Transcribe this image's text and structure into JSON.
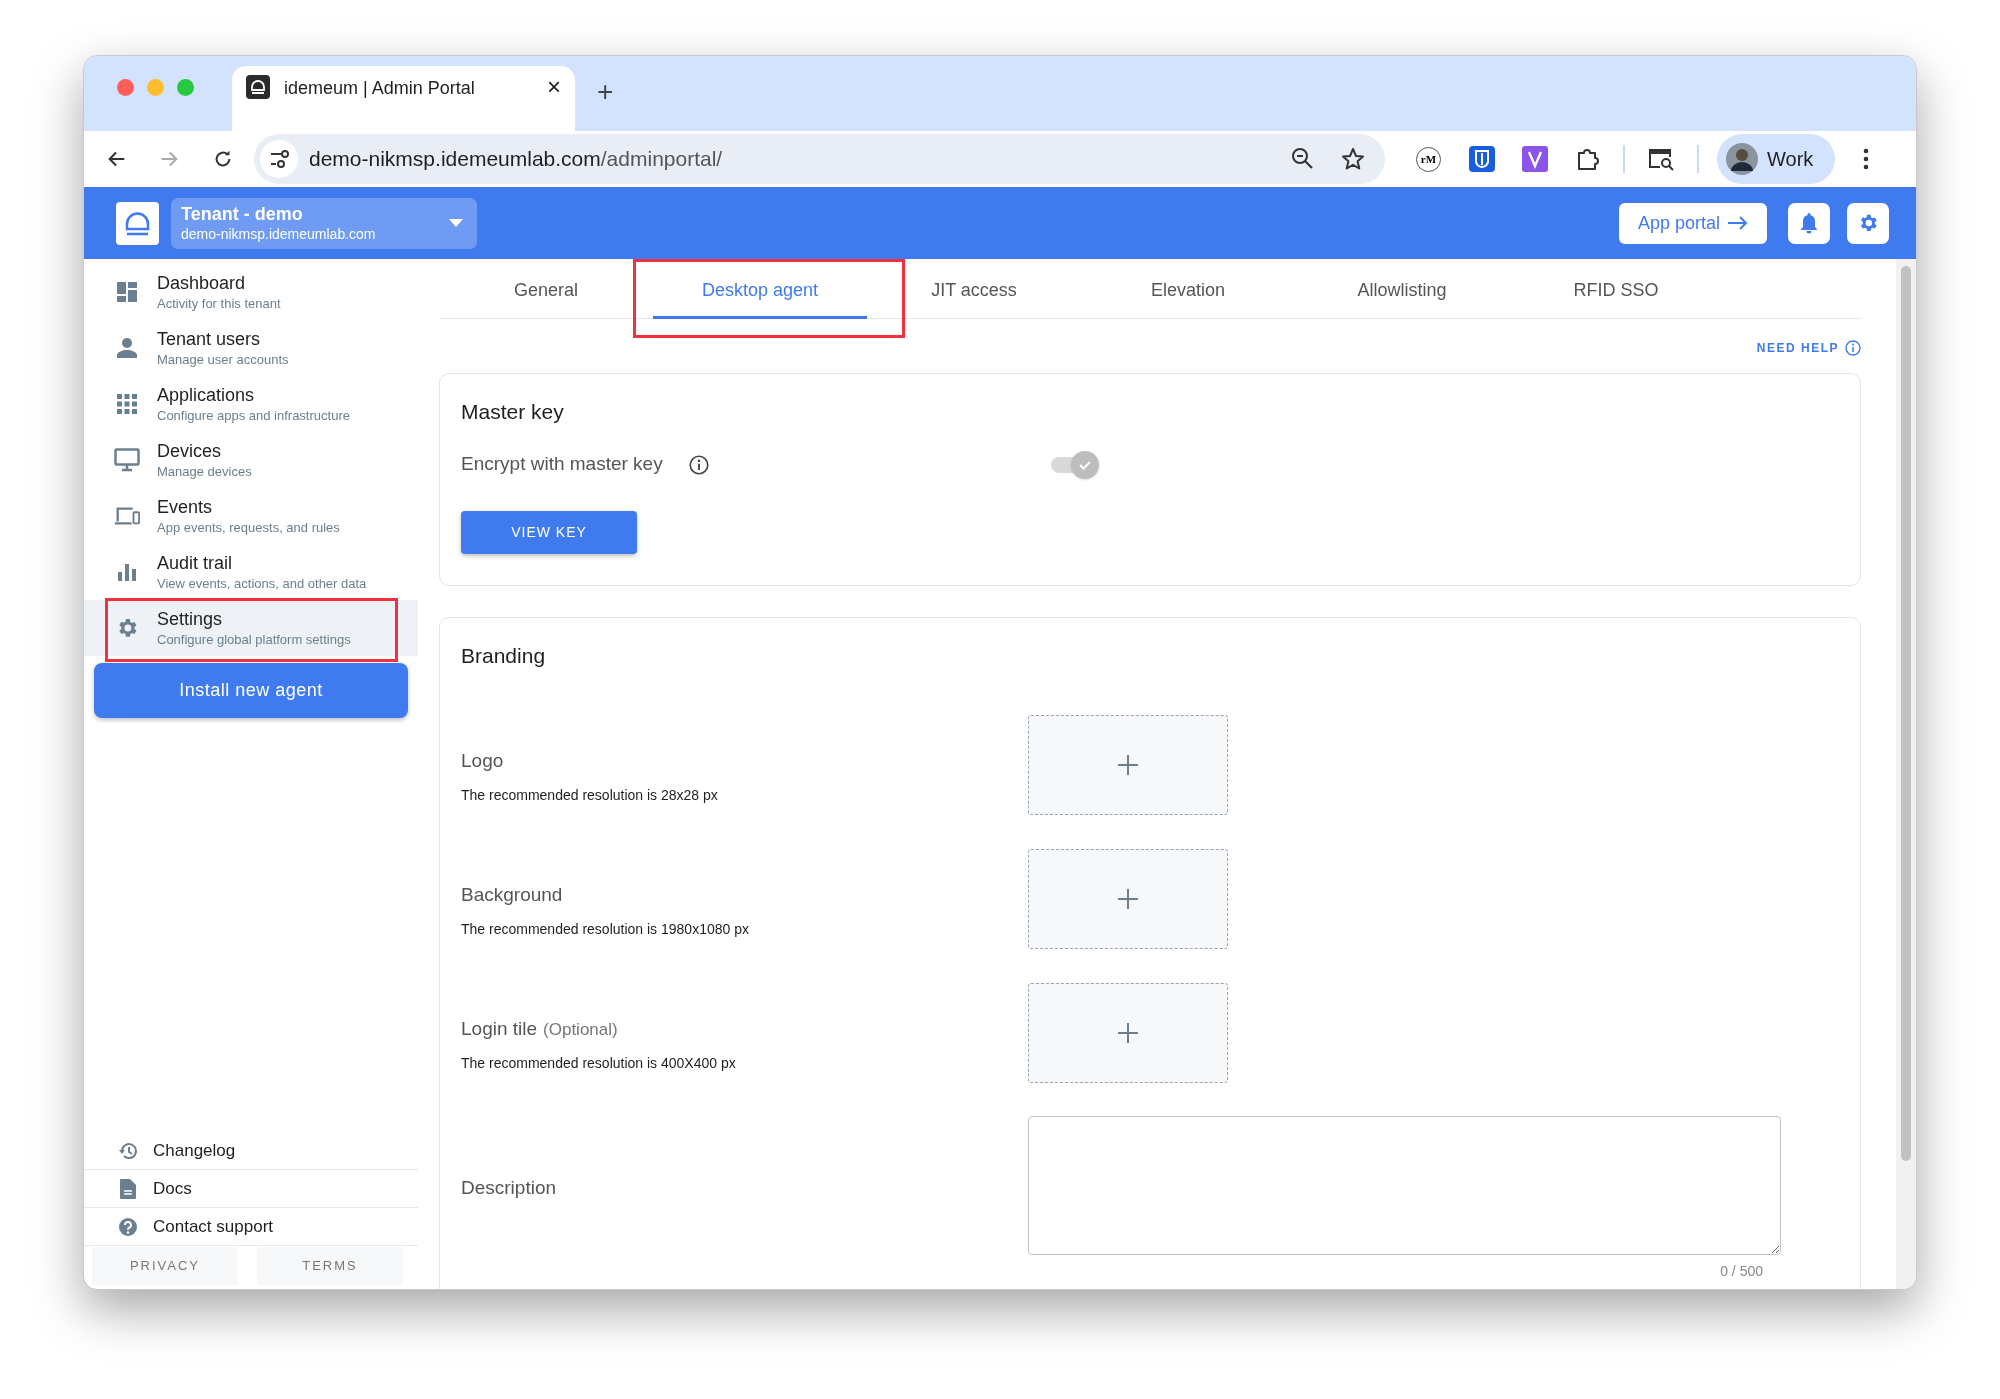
{
  "browser": {
    "tab_title": "idemeum | Admin Portal",
    "new_tab": "+",
    "close": "×",
    "url_host": "demo-nikmsp.idemeumlab.com",
    "url_path": "/adminportal/",
    "extension_rm": "rM",
    "profile": "Work"
  },
  "header": {
    "tenant_name": "Tenant - demo",
    "tenant_domain": "demo-nikmsp.idemeumlab.com",
    "app_portal": "App portal"
  },
  "sidebar": {
    "nav": [
      {
        "title": "Dashboard",
        "subtitle": "Activity for this tenant",
        "selected": false,
        "highlighted": false
      },
      {
        "title": "Tenant users",
        "subtitle": "Manage user accounts",
        "selected": false,
        "highlighted": false
      },
      {
        "title": "Applications",
        "subtitle": "Configure apps and infrastructure",
        "selected": false,
        "highlighted": false
      },
      {
        "title": "Devices",
        "subtitle": "Manage devices",
        "selected": false,
        "highlighted": false
      },
      {
        "title": "Events",
        "subtitle": "App events, requests, and rules",
        "selected": false,
        "highlighted": false
      },
      {
        "title": "Audit trail",
        "subtitle": "View events, actions, and other data",
        "selected": false,
        "highlighted": false
      },
      {
        "title": "Settings",
        "subtitle": "Configure global platform settings",
        "selected": true,
        "highlighted": true
      }
    ],
    "install_button": "Install new agent",
    "footer_links": [
      "Changelog",
      "Docs",
      "Contact support"
    ],
    "legal": [
      "PRIVACY",
      "TERMS"
    ]
  },
  "tabs": [
    {
      "label": "General",
      "selected": false,
      "highlighted": false
    },
    {
      "label": "Desktop agent",
      "selected": true,
      "highlighted": true
    },
    {
      "label": "JIT access",
      "selected": false,
      "highlighted": false
    },
    {
      "label": "Elevation",
      "selected": false,
      "highlighted": false
    },
    {
      "label": "Allowlisting",
      "selected": false,
      "highlighted": false
    },
    {
      "label": "RFID SSO",
      "selected": false,
      "highlighted": false
    }
  ],
  "need_help": "NEED HELP",
  "master_key": {
    "title": "Master key",
    "toggle_label": "Encrypt with master key",
    "toggle": {
      "on": true,
      "disabled": true
    },
    "button": "VIEW KEY"
  },
  "branding": {
    "title": "Branding",
    "uploads": [
      {
        "label": "Logo",
        "hint": "The recommended resolution is 28x28 px"
      },
      {
        "label": "Background",
        "hint": "The recommended resolution is 1980x1080 px"
      },
      {
        "label": "Login tile",
        "note": "(Optional)",
        "hint": "The recommended resolution is 400X400 px"
      }
    ],
    "description": {
      "label": "Description",
      "counter": "0 / 500"
    }
  }
}
